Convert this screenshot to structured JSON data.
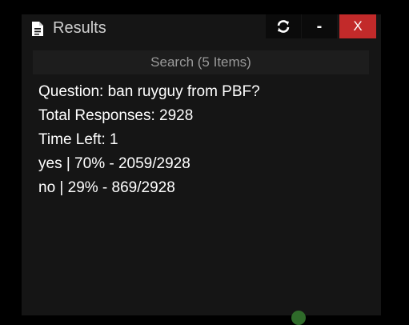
{
  "window": {
    "title": "Results",
    "icon": "document-icon",
    "buttons": {
      "refresh_icon": "refresh-icon",
      "minimize_label": "-",
      "close_label": "X"
    }
  },
  "search": {
    "label": "Search (5 Items)"
  },
  "results": {
    "lines": [
      "Question: ban ruyguy from PBF?",
      "Total Responses: 2928",
      "Time Left: 1",
      "yes | 70% - 2059/2928",
      "no | 29% - 869/2928"
    ]
  },
  "colors": {
    "background": "#000000",
    "panel": "#151515",
    "close_button": "#c22a2a",
    "text": "#ffffff"
  }
}
